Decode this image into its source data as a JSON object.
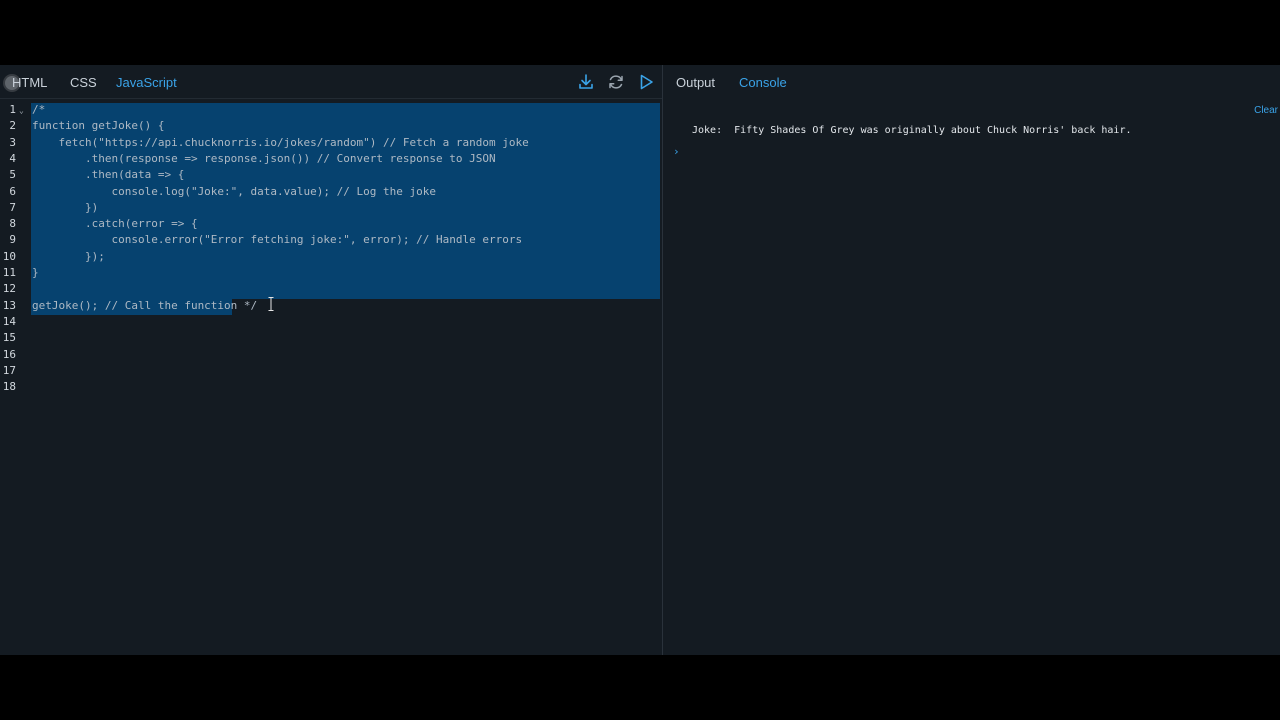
{
  "editor": {
    "tabs": [
      {
        "label": "HTML"
      },
      {
        "label": "CSS"
      },
      {
        "label": "JavaScript"
      }
    ],
    "toolbar": {
      "download_icon": "download-icon",
      "reload_icon": "reload-icon",
      "run_icon": "play-icon"
    },
    "lines": [
      {
        "num": "1",
        "text": "/*"
      },
      {
        "num": "2",
        "text": "function getJoke() {"
      },
      {
        "num": "3",
        "text": "    fetch(\"https://api.chucknorris.io/jokes/random\") // Fetch a random joke"
      },
      {
        "num": "4",
        "text": "        .then(response => response.json()) // Convert response to JSON"
      },
      {
        "num": "5",
        "text": "        .then(data => {"
      },
      {
        "num": "6",
        "text": "            console.log(\"Joke:\", data.value); // Log the joke"
      },
      {
        "num": "7",
        "text": "        })"
      },
      {
        "num": "8",
        "text": "        .catch(error => {"
      },
      {
        "num": "9",
        "text": "            console.error(\"Error fetching joke:\", error); // Handle errors"
      },
      {
        "num": "10",
        "text": "        });"
      },
      {
        "num": "11",
        "text": "}"
      },
      {
        "num": "12",
        "text": ""
      },
      {
        "num": "13",
        "text": "getJoke(); // Call the function */"
      },
      {
        "num": "14",
        "text": ""
      },
      {
        "num": "15",
        "text": ""
      },
      {
        "num": "16",
        "text": ""
      },
      {
        "num": "17",
        "text": ""
      },
      {
        "num": "18",
        "text": ""
      }
    ]
  },
  "output": {
    "tabs": [
      {
        "label": "Output"
      },
      {
        "label": "Console"
      }
    ],
    "clear_label": "Clear",
    "console_log": "Joke:  Fifty Shades Of Grey was originally about Chuck Norris' back hair.",
    "prompt_symbol": "›"
  },
  "colors": {
    "accent": "#3aa3e8",
    "selection": "#06426f",
    "background": "#141b22"
  }
}
